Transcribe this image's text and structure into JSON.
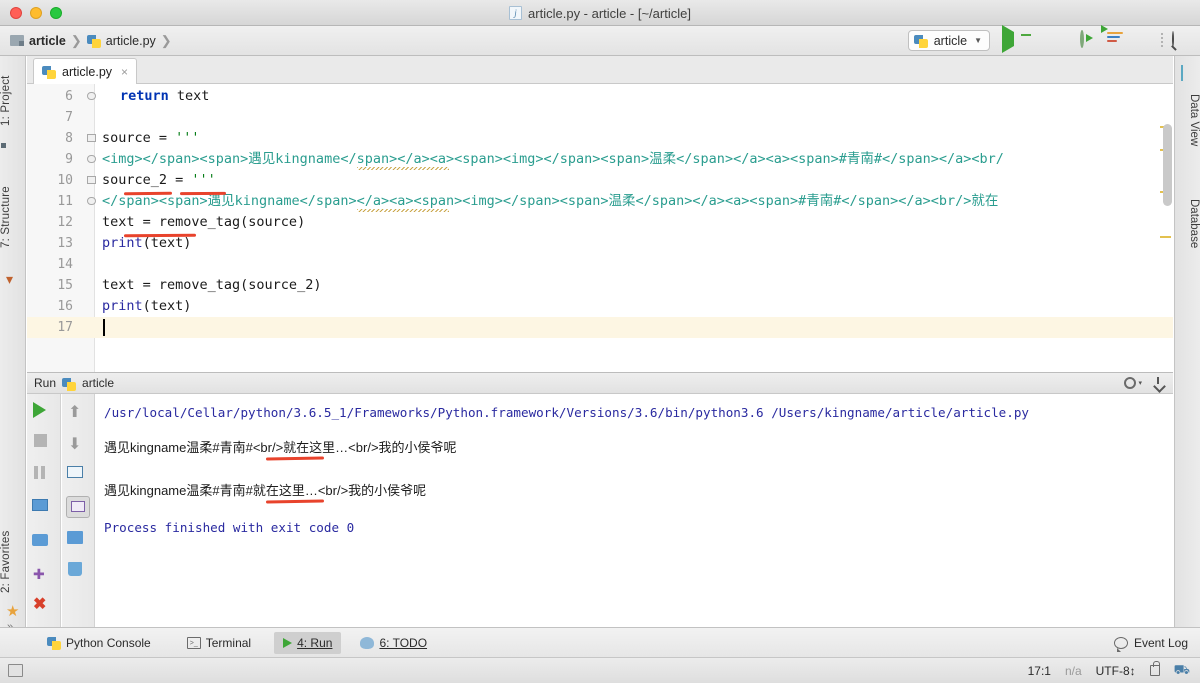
{
  "window": {
    "title": "article.py - article - [~/article]",
    "file_icon": "python-file-icon"
  },
  "breadcrumb": {
    "items": [
      {
        "label": "article",
        "icon": "folder-icon"
      },
      {
        "label": "article.py",
        "icon": "python-file-icon"
      }
    ],
    "separator": "❯"
  },
  "toolbar": {
    "run_config": "article",
    "run_config_caret": "▼",
    "icons": [
      "run-icon",
      "debug-icon",
      "coverage-icon",
      "profile-icon",
      "attach-icon",
      "stop-icon",
      "search-everywhere-icon"
    ]
  },
  "left_stripe": {
    "items": [
      {
        "label": "1: Project",
        "icon": "project-icon"
      },
      {
        "label": "7: Structure",
        "icon": "structure-icon"
      },
      {
        "label": "2: Favorites",
        "icon": "star-icon"
      }
    ],
    "expand_label": "»"
  },
  "right_stripe": {
    "items": [
      {
        "label": "Data View",
        "icon": "grid-icon"
      },
      {
        "label": "Database",
        "icon": "database-icon"
      }
    ]
  },
  "editor": {
    "tab": {
      "label": "article.py",
      "close": "×",
      "icon": "python-file-icon"
    },
    "lines": [
      {
        "num": "6",
        "indent": 2,
        "tokens": [
          {
            "t": "return ",
            "c": "k"
          },
          {
            "t": "text",
            "c": "fn"
          }
        ]
      },
      {
        "num": "7",
        "indent": 0,
        "tokens": []
      },
      {
        "num": "8",
        "indent": 0,
        "tokens": [
          {
            "t": "source = ",
            "c": "fn"
          },
          {
            "t": "'''",
            "c": "str"
          }
        ]
      },
      {
        "num": "9",
        "indent": 0,
        "tokens": [
          {
            "t": "<img></span><span>遇见kingname</span></a><a><span><img></span><span>温柔</span></a><a><span>#青南#</span></a><br/",
            "c": "html-str"
          }
        ]
      },
      {
        "num": "10",
        "indent": 0,
        "tokens": [
          {
            "t": "source_2 = ",
            "c": "fn"
          },
          {
            "t": "'''",
            "c": "str"
          }
        ]
      },
      {
        "num": "11",
        "indent": 0,
        "tokens": [
          {
            "t": "</span><span>遇见kingname</span></a><a><span><img></span><span>温柔</span></a><a><span>#青南#</span></a><br/>就在",
            "c": "html-str"
          }
        ]
      },
      {
        "num": "12",
        "indent": 0,
        "tokens": [
          {
            "t": "text = remove_tag(source)",
            "c": "fn"
          }
        ]
      },
      {
        "num": "13",
        "indent": 0,
        "tokens": [
          {
            "t": "print",
            "c": "builtin"
          },
          {
            "t": "(text)",
            "c": "fn"
          }
        ]
      },
      {
        "num": "14",
        "indent": 0,
        "tokens": []
      },
      {
        "num": "15",
        "indent": 0,
        "tokens": [
          {
            "t": "text = remove_tag(source_2)",
            "c": "fn"
          }
        ]
      },
      {
        "num": "16",
        "indent": 0,
        "tokens": [
          {
            "t": "print",
            "c": "builtin"
          },
          {
            "t": "(text)",
            "c": "fn"
          }
        ]
      },
      {
        "num": "17",
        "indent": 0,
        "tokens": [],
        "highlight": true,
        "caret": true
      }
    ],
    "annotations": [
      {
        "type": "red-underline",
        "target_line": "9",
        "note": "underline under <img>"
      },
      {
        "type": "red-underline",
        "target_line": "11",
        "note": "underline under </span>"
      }
    ]
  },
  "run_panel": {
    "header": {
      "label": "Run",
      "config": "article",
      "icon": "python-icon"
    },
    "toolbar_icons": [
      "rerun-icon",
      "stop-icon",
      "pause-icon",
      "expose-icon",
      "print-icon",
      "pin-icon",
      "close-icon",
      "up-icon",
      "down-icon",
      "soft-wrap-icon",
      "scroll-to-end-icon",
      "print-output-icon",
      "trash-icon"
    ],
    "output": [
      {
        "text": "/usr/local/Cellar/python/3.6.5_1/Frameworks/Python.framework/Versions/3.6/bin/python3.6 /Users/kingname/article/article.py",
        "style": "mono"
      },
      {
        "text": "遇见kingname温柔#青南#<br/>就在这里…<br/>我的小侯爷呢",
        "style": "cjk"
      },
      {
        "text": "遇见kingname温柔#青南#就在这里…<br/>我的小侯爷呢",
        "style": "cjk"
      },
      {
        "text": "Process finished with exit code 0",
        "style": "mono"
      }
    ]
  },
  "bottom_tabs": {
    "items": [
      {
        "label": "Python Console",
        "icon": "python-console-icon",
        "active": false,
        "mnemonic": ""
      },
      {
        "label": "Terminal",
        "icon": "terminal-icon",
        "active": false,
        "mnemonic": ""
      },
      {
        "label": "4: Run",
        "icon": "run-icon",
        "active": true,
        "mnemonic": "4"
      },
      {
        "label": "6: TODO",
        "icon": "todo-icon",
        "active": false,
        "mnemonic": "6"
      }
    ],
    "event_log": {
      "label": "Event Log",
      "icon": "balloon-icon"
    }
  },
  "status_bar": {
    "caret_position": "17:1",
    "line_separator": "n/a",
    "encoding": "UTF-8",
    "encoding_caret": "↕",
    "lock_icon": "lock-icon",
    "inspection_icon": "ferry-icon",
    "window_icon": "window-icon"
  },
  "colors": {
    "accent_green": "#3ea637",
    "html_string": "#2a9d8f",
    "keyword_blue": "#0033b3",
    "console_blue": "#2a2aa0",
    "annotation_red": "#e8432c",
    "highlight_row": "#fdf6e3"
  }
}
